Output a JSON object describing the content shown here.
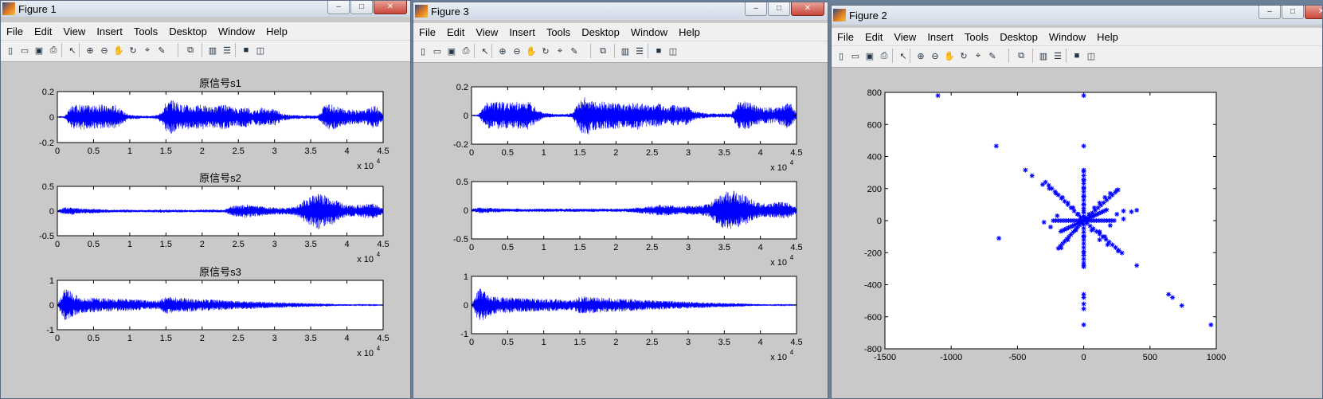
{
  "windows": [
    {
      "id": "figure1",
      "title": "Figure 1"
    },
    {
      "id": "figure3",
      "title": "Figure 3"
    },
    {
      "id": "figure2",
      "title": "Figure 2"
    }
  ],
  "menu": [
    "File",
    "Edit",
    "View",
    "Insert",
    "Tools",
    "Desktop",
    "Window",
    "Help"
  ],
  "toolbar_icons": [
    "new-file-icon",
    "open-folder-icon",
    "save-icon",
    "print-icon",
    "select-arrow-icon",
    "zoom-in-icon",
    "zoom-out-icon",
    "pan-hand-icon",
    "rotate-3d-icon",
    "data-cursor-icon",
    "brush-icon",
    "link-plot-icon",
    "colorbar-icon",
    "legend-icon",
    "hide-plot-tools-icon",
    "show-plot-tools-icon"
  ],
  "window_buttons": {
    "minimize": "–",
    "maximize": "□",
    "close": "✕"
  },
  "figure1": {
    "subplots": [
      {
        "title": "原信号s1",
        "yticks": [
          "0.2",
          "0",
          "-0.2"
        ]
      },
      {
        "title": "原信号s2",
        "yticks": [
          "0.5",
          "0",
          "-0.5"
        ]
      },
      {
        "title": "原信号s3",
        "yticks": [
          "1",
          "0",
          "-1"
        ]
      }
    ]
  },
  "figure3": {
    "subplots": [
      {
        "title": "",
        "yticks": [
          "0.2",
          "0",
          "-0.2"
        ]
      },
      {
        "title": "",
        "yticks": [
          "0.5",
          "0",
          "-0.5"
        ]
      },
      {
        "title": "",
        "yticks": [
          "1",
          "0",
          "-1"
        ]
      }
    ]
  },
  "time_axis": {
    "xticks": [
      "0",
      "0.5",
      "1",
      "1.5",
      "2",
      "2.5",
      "3",
      "3.5",
      "4",
      "4.5"
    ],
    "multiplier": "x 10",
    "exponent": "4"
  },
  "chart_data": [
    {
      "type": "line",
      "figure": "Figure 1",
      "title": "原信号s1",
      "xlim": [
        0,
        45000
      ],
      "ylim": [
        -0.2,
        0.2
      ],
      "color": "#0000ff",
      "envelope_x": [
        0,
        1000,
        2000,
        3000,
        4000,
        5000,
        6000,
        7000,
        8000,
        9000,
        10000,
        11000,
        12000,
        13000,
        14000,
        15000,
        16000,
        17000,
        18000,
        19000,
        20000,
        21000,
        22000,
        23000,
        24000,
        25000,
        26000,
        27000,
        28000,
        29000,
        30000,
        31000,
        32000,
        33000,
        34000,
        35000,
        36000,
        37000,
        38000,
        39000,
        40000,
        41000,
        42000,
        43000,
        44000,
        45000
      ],
      "envelope": [
        0,
        0.01,
        0.09,
        0.1,
        0.1,
        0.09,
        0.1,
        0.09,
        0.1,
        0.05,
        0.02,
        0.015,
        0.01,
        0.01,
        0.02,
        0.12,
        0.14,
        0.1,
        0.1,
        0.09,
        0.1,
        0.08,
        0.09,
        0.1,
        0.08,
        0.07,
        0.09,
        0.05,
        0.08,
        0.06,
        0.07,
        0.03,
        0.02,
        0.015,
        0.015,
        0.015,
        0.015,
        0.1,
        0.1,
        0.08,
        0.06,
        0.06,
        0.05,
        0.07,
        0.1,
        0.02
      ]
    },
    {
      "type": "line",
      "figure": "Figure 1",
      "title": "原信号s2",
      "xlim": [
        0,
        45000
      ],
      "ylim": [
        -0.5,
        0.5
      ],
      "color": "#0000ff",
      "envelope_x": [
        0,
        1000,
        2000,
        3000,
        4000,
        5000,
        6000,
        7000,
        8000,
        9000,
        10000,
        11000,
        12000,
        13000,
        14000,
        15000,
        16000,
        17000,
        18000,
        19000,
        20000,
        21000,
        22000,
        23000,
        24000,
        25000,
        26000,
        27000,
        28000,
        29000,
        30000,
        31000,
        32000,
        33000,
        34000,
        35000,
        36000,
        37000,
        38000,
        39000,
        40000,
        41000,
        42000,
        43000,
        44000,
        45000
      ],
      "envelope": [
        0.02,
        0.08,
        0.08,
        0.06,
        0.05,
        0.05,
        0.04,
        0.035,
        0.03,
        0.03,
        0.03,
        0.025,
        0.025,
        0.025,
        0.03,
        0.03,
        0.03,
        0.03,
        0.025,
        0.025,
        0.03,
        0.03,
        0.03,
        0.025,
        0.1,
        0.12,
        0.14,
        0.12,
        0.1,
        0.08,
        0.08,
        0.07,
        0.08,
        0.1,
        0.22,
        0.3,
        0.38,
        0.32,
        0.28,
        0.18,
        0.12,
        0.12,
        0.14,
        0.16,
        0.15,
        0.05
      ]
    },
    {
      "type": "line",
      "figure": "Figure 1",
      "title": "原信号s3",
      "xlim": [
        0,
        45000
      ],
      "ylim": [
        -1,
        1
      ],
      "color": "#0000ff",
      "envelope_x": [
        0,
        1000,
        2000,
        3000,
        4000,
        5000,
        6000,
        7000,
        8000,
        9000,
        10000,
        11000,
        12000,
        13000,
        14000,
        15000,
        16000,
        17000,
        18000,
        19000,
        20000,
        21000,
        22000,
        23000,
        24000,
        25000,
        26000,
        27000,
        28000,
        29000,
        30000,
        31000,
        32000,
        33000,
        34000,
        35000,
        36000,
        37000,
        38000,
        39000,
        40000,
        41000,
        42000,
        43000,
        44000,
        45000
      ],
      "envelope": [
        0,
        0.7,
        0.55,
        0.35,
        0.3,
        0.3,
        0.28,
        0.27,
        0.26,
        0.25,
        0.24,
        0.24,
        0.2,
        0.18,
        0.18,
        0.36,
        0.34,
        0.3,
        0.28,
        0.26,
        0.24,
        0.23,
        0.22,
        0.2,
        0.18,
        0.17,
        0.16,
        0.15,
        0.14,
        0.13,
        0.12,
        0.11,
        0.1,
        0.09,
        0.08,
        0.08,
        0.07,
        0.06,
        0.05,
        0.04,
        0.035,
        0.03,
        0.02,
        0.02,
        0.015,
        0.01
      ]
    },
    {
      "type": "line",
      "figure": "Figure 3",
      "xlim": [
        0,
        45000
      ],
      "ylim": [
        -0.2,
        0.2
      ],
      "color": "#0000ff",
      "envelope_x": [
        0,
        1000,
        2000,
        3000,
        4000,
        5000,
        6000,
        7000,
        8000,
        9000,
        10000,
        11000,
        12000,
        13000,
        14000,
        15000,
        16000,
        17000,
        18000,
        19000,
        20000,
        21000,
        22000,
        23000,
        24000,
        25000,
        26000,
        27000,
        28000,
        29000,
        30000,
        31000,
        32000,
        33000,
        34000,
        35000,
        36000,
        37000,
        38000,
        39000,
        40000,
        41000,
        42000,
        43000,
        44000,
        45000
      ],
      "envelope": [
        0,
        0.01,
        0.09,
        0.1,
        0.1,
        0.09,
        0.1,
        0.09,
        0.1,
        0.05,
        0.02,
        0.015,
        0.01,
        0.01,
        0.02,
        0.12,
        0.14,
        0.1,
        0.1,
        0.09,
        0.1,
        0.08,
        0.09,
        0.1,
        0.08,
        0.07,
        0.09,
        0.05,
        0.08,
        0.06,
        0.07,
        0.03,
        0.02,
        0.015,
        0.015,
        0.015,
        0.015,
        0.1,
        0.1,
        0.08,
        0.06,
        0.06,
        0.05,
        0.07,
        0.1,
        0.02
      ]
    },
    {
      "type": "line",
      "figure": "Figure 3",
      "xlim": [
        0,
        45000
      ],
      "ylim": [
        -0.5,
        0.5
      ],
      "color": "#0000ff",
      "envelope_x": [
        0,
        1000,
        2000,
        3000,
        4000,
        5000,
        6000,
        7000,
        8000,
        9000,
        10000,
        11000,
        12000,
        13000,
        14000,
        15000,
        16000,
        17000,
        18000,
        19000,
        20000,
        21000,
        22000,
        23000,
        24000,
        25000,
        26000,
        27000,
        28000,
        29000,
        30000,
        31000,
        32000,
        33000,
        34000,
        35000,
        36000,
        37000,
        38000,
        39000,
        40000,
        41000,
        42000,
        43000,
        44000,
        45000
      ],
      "envelope": [
        0.02,
        0.05,
        0.05,
        0.04,
        0.035,
        0.03,
        0.03,
        0.03,
        0.03,
        0.03,
        0.03,
        0.03,
        0.03,
        0.03,
        0.03,
        0.03,
        0.03,
        0.03,
        0.03,
        0.03,
        0.03,
        0.03,
        0.035,
        0.05,
        0.06,
        0.08,
        0.1,
        0.09,
        0.08,
        0.07,
        0.08,
        0.08,
        0.09,
        0.12,
        0.25,
        0.32,
        0.36,
        0.3,
        0.26,
        0.18,
        0.12,
        0.12,
        0.14,
        0.15,
        0.14,
        0.05
      ]
    },
    {
      "type": "line",
      "figure": "Figure 3",
      "xlim": [
        0,
        45000
      ],
      "ylim": [
        -1,
        1
      ],
      "color": "#0000ff",
      "envelope_x": [
        0,
        1000,
        2000,
        3000,
        4000,
        5000,
        6000,
        7000,
        8000,
        9000,
        10000,
        11000,
        12000,
        13000,
        14000,
        15000,
        16000,
        17000,
        18000,
        19000,
        20000,
        21000,
        22000,
        23000,
        24000,
        25000,
        26000,
        27000,
        28000,
        29000,
        30000,
        31000,
        32000,
        33000,
        34000,
        35000,
        36000,
        37000,
        38000,
        39000,
        40000,
        41000,
        42000,
        43000,
        44000,
        45000
      ],
      "envelope": [
        0,
        0.6,
        0.5,
        0.32,
        0.28,
        0.28,
        0.26,
        0.25,
        0.24,
        0.23,
        0.22,
        0.22,
        0.2,
        0.18,
        0.18,
        0.3,
        0.3,
        0.28,
        0.26,
        0.25,
        0.23,
        0.22,
        0.21,
        0.2,
        0.18,
        0.17,
        0.16,
        0.15,
        0.14,
        0.13,
        0.12,
        0.11,
        0.1,
        0.09,
        0.08,
        0.08,
        0.07,
        0.06,
        0.05,
        0.04,
        0.035,
        0.03,
        0.02,
        0.02,
        0.015,
        0.01
      ]
    },
    {
      "type": "scatter",
      "figure": "Figure 2",
      "marker": "*",
      "color": "#0000ff",
      "xlim": [
        -1500,
        1000
      ],
      "ylim": [
        -800,
        800
      ],
      "xticks": [
        "-1500",
        "-1000",
        "-500",
        "0",
        "500",
        "1000"
      ],
      "yticks": [
        "800",
        "600",
        "400",
        "200",
        "0",
        "-200",
        "-400",
        "-600",
        "-800"
      ],
      "points": [
        [
          -1100,
          780
        ],
        [
          0,
          780
        ],
        [
          -660,
          465
        ],
        [
          0,
          465
        ],
        [
          -440,
          315
        ],
        [
          -390,
          280
        ],
        [
          0,
          315
        ],
        [
          0,
          250
        ],
        [
          -310,
          225
        ],
        [
          -260,
          200
        ],
        [
          -210,
          170
        ],
        [
          -160,
          145
        ],
        [
          -120,
          110
        ],
        [
          -80,
          80
        ],
        [
          -40,
          40
        ],
        [
          0,
          200
        ],
        [
          0,
          150
        ],
        [
          0,
          100
        ],
        [
          0,
          60
        ],
        [
          0,
          20
        ],
        [
          40,
          40
        ],
        [
          80,
          80
        ],
        [
          120,
          110
        ],
        [
          160,
          145
        ],
        [
          200,
          170
        ],
        [
          250,
          190
        ],
        [
          300,
          60
        ],
        [
          360,
          55
        ],
        [
          400,
          65
        ],
        [
          120,
          -70
        ],
        [
          160,
          -100
        ],
        [
          -170,
          -170
        ],
        [
          -120,
          -120
        ],
        [
          -60,
          -60
        ],
        [
          60,
          -60
        ],
        [
          120,
          -120
        ],
        [
          180,
          -150
        ],
        [
          260,
          -190
        ],
        [
          400,
          -280
        ],
        [
          0,
          -100
        ],
        [
          0,
          -200
        ],
        [
          0,
          -280
        ],
        [
          -640,
          -110
        ],
        [
          0,
          -460
        ],
        [
          0,
          -480
        ],
        [
          0,
          -520
        ],
        [
          0,
          -550
        ],
        [
          0,
          -650
        ],
        [
          640,
          -460
        ],
        [
          670,
          -480
        ],
        [
          740,
          -530
        ],
        [
          960,
          -650
        ],
        [
          -200,
          30
        ],
        [
          200,
          -30
        ],
        [
          -250,
          -40
        ],
        [
          250,
          40
        ],
        [
          -300,
          -10
        ],
        [
          300,
          10
        ]
      ],
      "rays": [
        [
          -300,
          250
        ],
        [
          270,
          200
        ],
        [
          -200,
          -180
        ],
        [
          300,
          -210
        ],
        [
          0,
          320
        ],
        [
          0,
          -300
        ],
        [
          -240,
          0
        ],
        [
          240,
          0
        ],
        [
          180,
          70
        ],
        [
          -180,
          -70
        ]
      ]
    }
  ]
}
